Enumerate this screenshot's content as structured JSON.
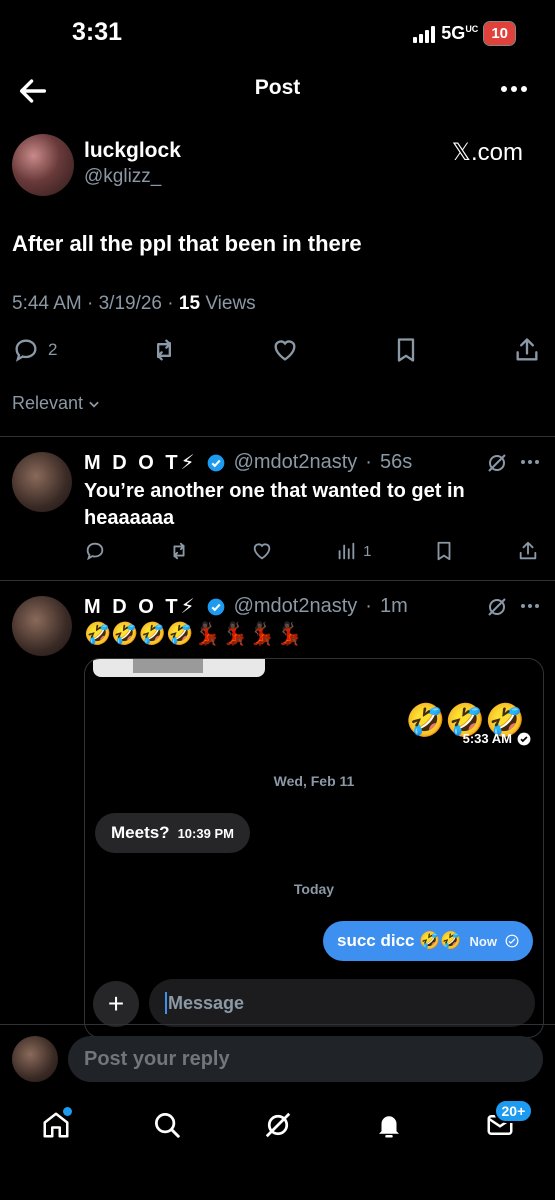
{
  "status_bar": {
    "time": "3:31",
    "network": "5G",
    "network_sup": "UC",
    "battery": "10"
  },
  "header": {
    "title": "Post"
  },
  "post": {
    "author_name": "luckglock",
    "author_handle": "@kglizz_",
    "source": "𝕏.com",
    "text": "After all the ppl that been in there",
    "time": "5:44 AM",
    "date": "3/19/26",
    "views_count": "15",
    "views_label": "Views",
    "reply_count": "2"
  },
  "sort": {
    "label": "Relevant"
  },
  "replies": [
    {
      "name": "M D O T⚡",
      "handle": "@mdot2nasty",
      "age": "56s",
      "text": "You’re another one that wanted to get in heaaaaaa",
      "views": "1"
    },
    {
      "name": "M D O T⚡",
      "handle": "@mdot2nasty",
      "age": "1m",
      "text": "🤣🤣🤣🤣💃🏿💃🏿💃🏿💃🏿"
    }
  ],
  "embed": {
    "emojis": "🤣🤣🤣",
    "sent_time": "5:33 AM",
    "date_separator": "Wed, Feb 11",
    "incoming_text": "Meets?",
    "incoming_time": "10:39 PM",
    "today_separator": "Today",
    "outgoing_text": "succ dicc 🤣🤣",
    "outgoing_time": "Now",
    "input_placeholder": "Message"
  },
  "reply_bar": {
    "placeholder": "Post your reply"
  },
  "tabbar": {
    "messages_badge": "20+"
  },
  "colors": {
    "accent": "#1d9bf0",
    "imessage_blue": "#3d8ff0",
    "battery_red": "#e0413b"
  }
}
